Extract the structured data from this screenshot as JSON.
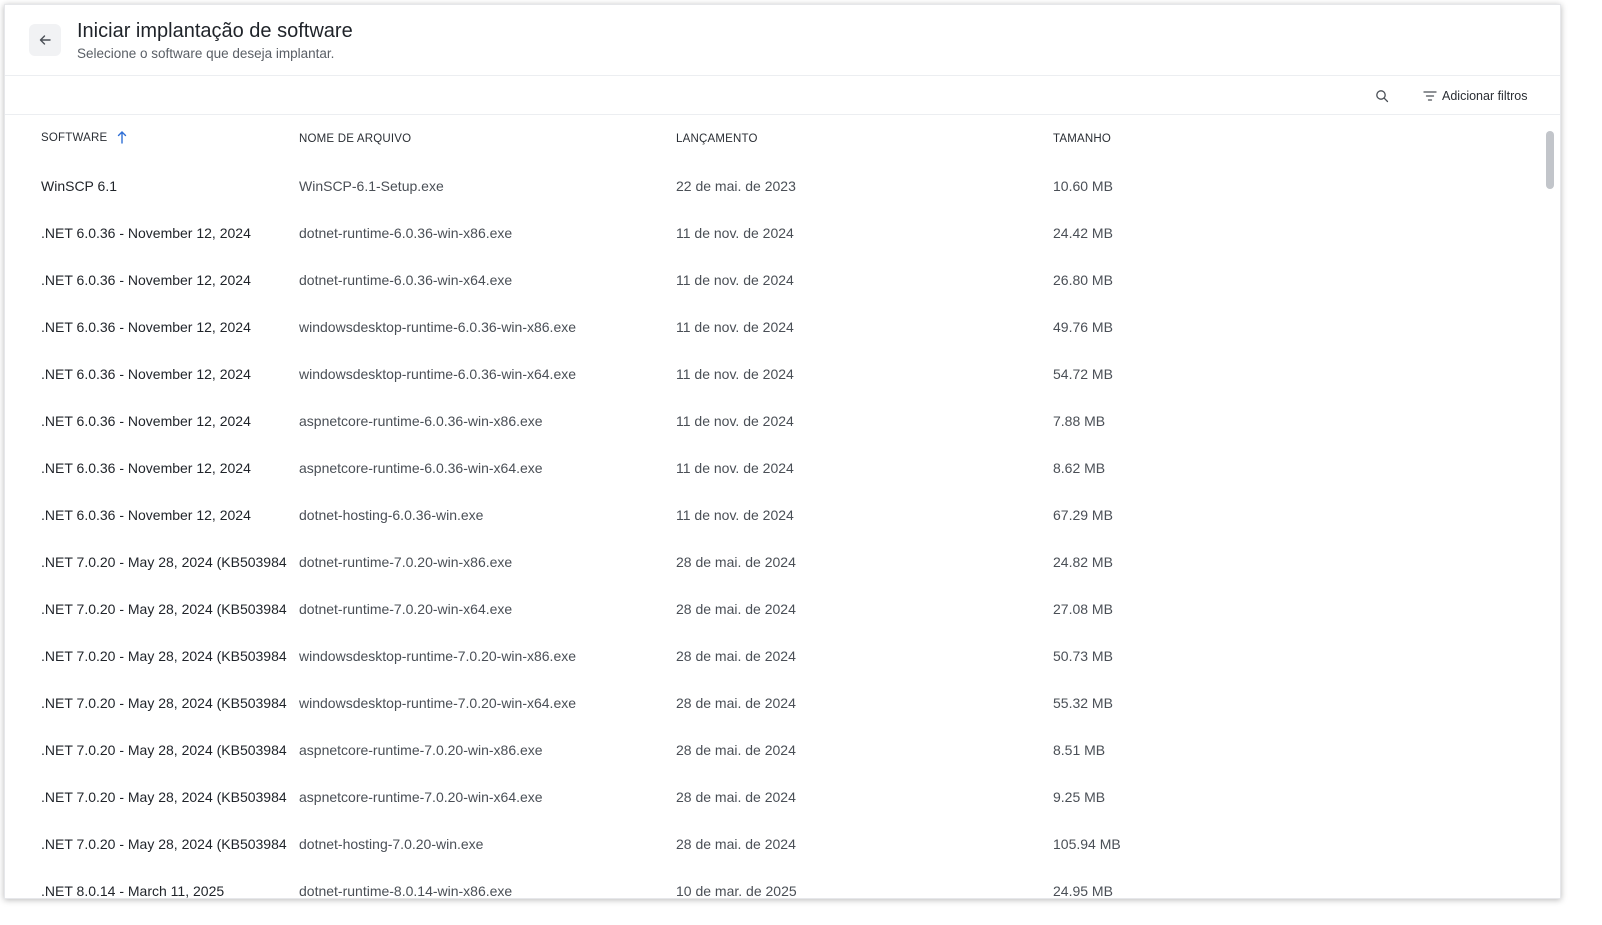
{
  "header": {
    "title": "Iniciar implantação de software",
    "subtitle": "Selecione o software que deseja implantar.",
    "back_icon": "arrow-left-icon"
  },
  "toolbar": {
    "search_icon": "search-icon",
    "filter_icon": "filter-icon",
    "filter_label": "Adicionar filtros"
  },
  "table": {
    "columns": {
      "software": "SOFTWARE",
      "filename": "NOME DE ARQUIVO",
      "release": "LANÇAMENTO",
      "size": "TAMANHO"
    },
    "sort": {
      "column": "software",
      "direction": "asc",
      "icon": "arrow-up-icon"
    },
    "rows": [
      {
        "software": "WinSCP 6.1",
        "filename": "WinSCP-6.1-Setup.exe",
        "release": "22 de mai. de 2023",
        "size": "10.60 MB"
      },
      {
        "software": ".NET 6.0.36 - November 12, 2024",
        "filename": "dotnet-runtime-6.0.36-win-x86.exe",
        "release": "11 de nov. de 2024",
        "size": "24.42 MB"
      },
      {
        "software": ".NET 6.0.36 - November 12, 2024",
        "filename": "dotnet-runtime-6.0.36-win-x64.exe",
        "release": "11 de nov. de 2024",
        "size": "26.80 MB"
      },
      {
        "software": ".NET 6.0.36 - November 12, 2024",
        "filename": "windowsdesktop-runtime-6.0.36-win-x86.exe",
        "release": "11 de nov. de 2024",
        "size": "49.76 MB"
      },
      {
        "software": ".NET 6.0.36 - November 12, 2024",
        "filename": "windowsdesktop-runtime-6.0.36-win-x64.exe",
        "release": "11 de nov. de 2024",
        "size": "54.72 MB"
      },
      {
        "software": ".NET 6.0.36 - November 12, 2024",
        "filename": "aspnetcore-runtime-6.0.36-win-x86.exe",
        "release": "11 de nov. de 2024",
        "size": "7.88 MB"
      },
      {
        "software": ".NET 6.0.36 - November 12, 2024",
        "filename": "aspnetcore-runtime-6.0.36-win-x64.exe",
        "release": "11 de nov. de 2024",
        "size": "8.62 MB"
      },
      {
        "software": ".NET 6.0.36 - November 12, 2024",
        "filename": "dotnet-hosting-6.0.36-win.exe",
        "release": "11 de nov. de 2024",
        "size": "67.29 MB"
      },
      {
        "software": ".NET 7.0.20 - May 28, 2024 (KB503984",
        "filename": "dotnet-runtime-7.0.20-win-x86.exe",
        "release": "28 de mai. de 2024",
        "size": "24.82 MB"
      },
      {
        "software": ".NET 7.0.20 - May 28, 2024 (KB503984",
        "filename": "dotnet-runtime-7.0.20-win-x64.exe",
        "release": "28 de mai. de 2024",
        "size": "27.08 MB"
      },
      {
        "software": ".NET 7.0.20 - May 28, 2024 (KB503984",
        "filename": "windowsdesktop-runtime-7.0.20-win-x86.exe",
        "release": "28 de mai. de 2024",
        "size": "50.73 MB"
      },
      {
        "software": ".NET 7.0.20 - May 28, 2024 (KB503984",
        "filename": "windowsdesktop-runtime-7.0.20-win-x64.exe",
        "release": "28 de mai. de 2024",
        "size": "55.32 MB"
      },
      {
        "software": ".NET 7.0.20 - May 28, 2024 (KB503984",
        "filename": "aspnetcore-runtime-7.0.20-win-x86.exe",
        "release": "28 de mai. de 2024",
        "size": "8.51 MB"
      },
      {
        "software": ".NET 7.0.20 - May 28, 2024 (KB503984",
        "filename": "aspnetcore-runtime-7.0.20-win-x64.exe",
        "release": "28 de mai. de 2024",
        "size": "9.25 MB"
      },
      {
        "software": ".NET 7.0.20 - May 28, 2024 (KB503984",
        "filename": "dotnet-hosting-7.0.20-win.exe",
        "release": "28 de mai. de 2024",
        "size": "105.94 MB"
      },
      {
        "software": ".NET 8.0.14 - March 11, 2025",
        "filename": "dotnet-runtime-8.0.14-win-x86.exe",
        "release": "10 de mar. de 2025",
        "size": "24.95 MB"
      }
    ]
  },
  "colors": {
    "accent": "#2f6fd6",
    "text": "#1f2329",
    "muted": "#5a5f66",
    "divider": "#eceef1"
  }
}
